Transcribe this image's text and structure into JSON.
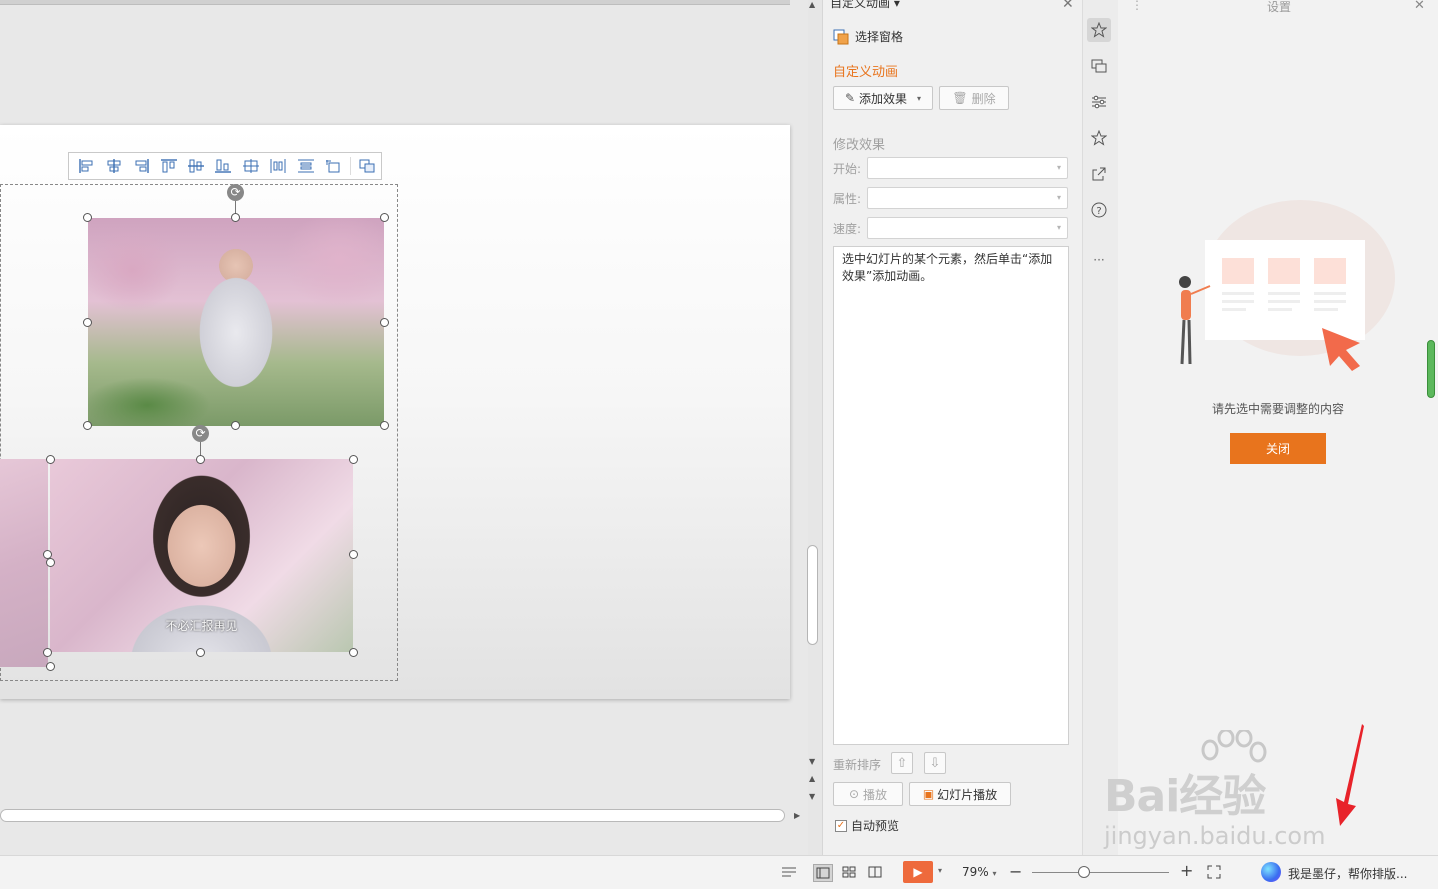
{
  "animation_pane": {
    "title": "自定义动画",
    "select_pane_label": "选择窗格",
    "section_title": "自定义动画",
    "add_effect_label": "添加效果",
    "delete_label": "删除",
    "modify_effect_label": "修改效果",
    "start_label": "开始:",
    "property_label": "属性:",
    "speed_label": "速度:",
    "hint_text": "选中幻灯片的某个元素，然后单击“添加效果”添加动画。",
    "reorder_label": "重新排序",
    "play_label": "播放",
    "slideshow_label": "幻灯片播放",
    "auto_preview_label": "自动预览",
    "auto_preview_checked": true
  },
  "settings_panel": {
    "title": "设置",
    "hint": "请先选中需要调整的内容",
    "close_button": "关闭"
  },
  "slide": {
    "photo_caption": "不必汇报再见"
  },
  "statusbar": {
    "zoom": "79%",
    "assistant_text": "我是墨仔，帮你排版..."
  },
  "watermark": {
    "brand": "Bai经验",
    "url": "jingyan.baidu.com"
  },
  "colors": {
    "accent_orange": "#e8741d",
    "toolbar_blue": "#3b6fb3"
  }
}
